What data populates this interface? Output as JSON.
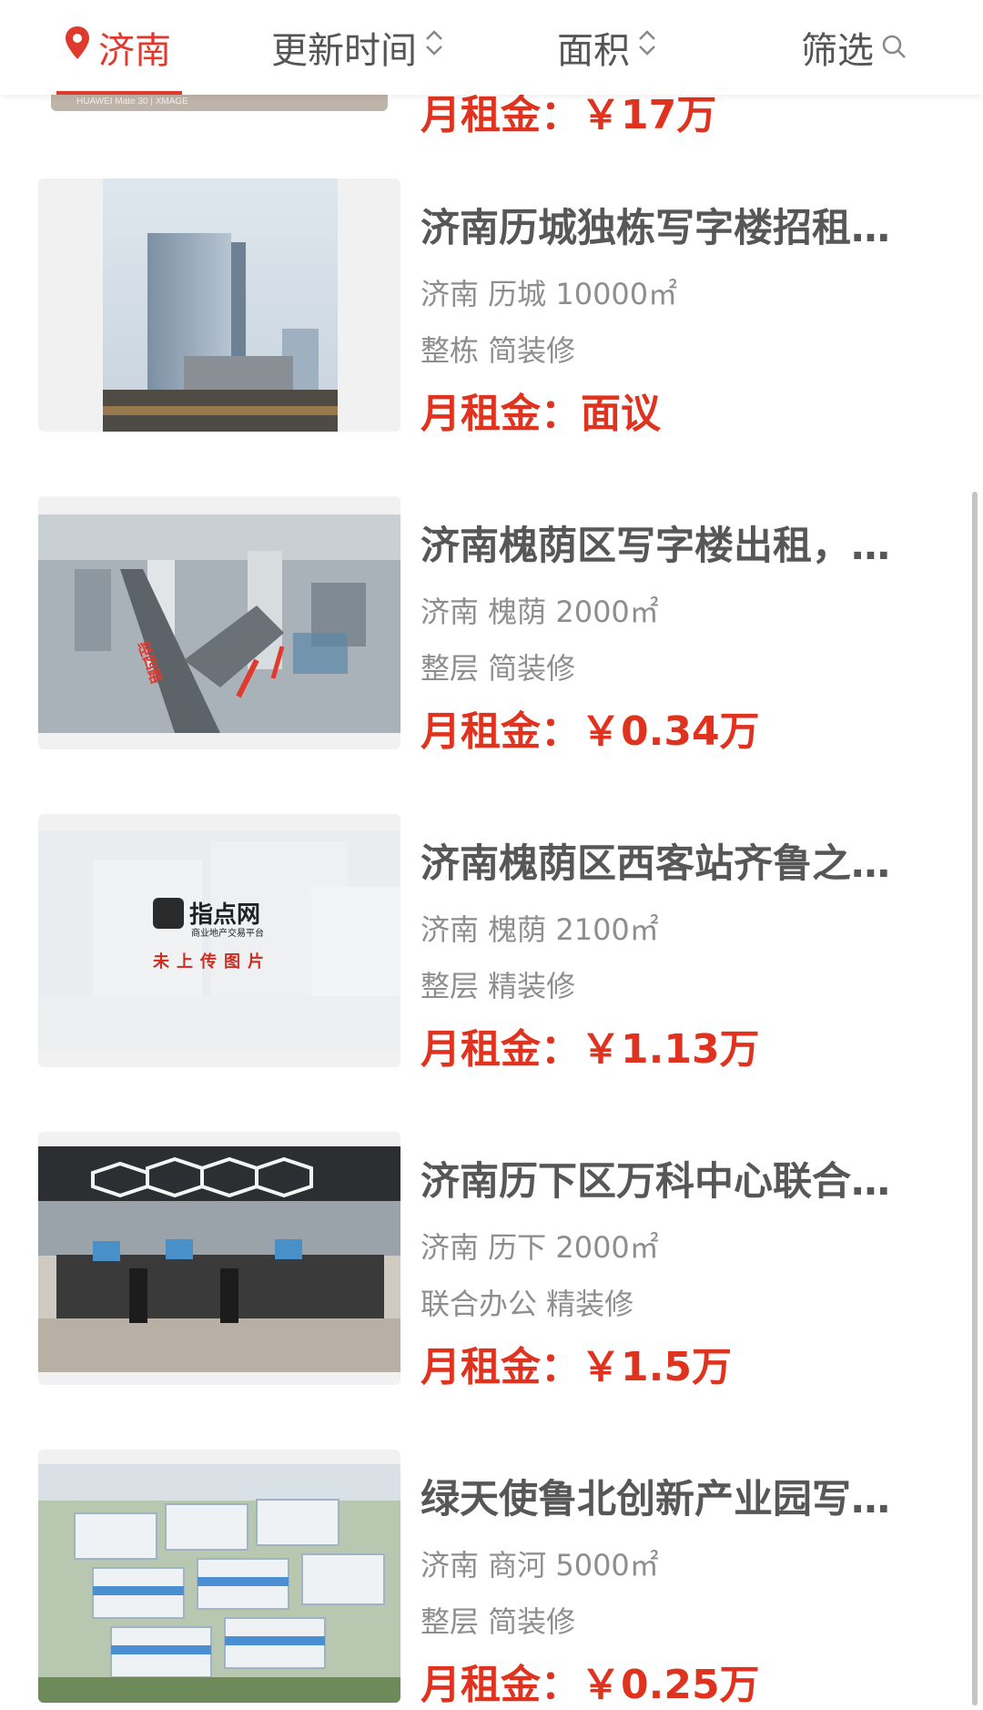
{
  "header": {
    "city": "济南",
    "sort_update": "更新时间",
    "sort_area": "面积",
    "filter": "筛选"
  },
  "listings": [
    {
      "title": "",
      "location": "",
      "spec": "",
      "price": "月租金：￥17万",
      "image_caption": "HUAWEI Mate 30 | XMAGE"
    },
    {
      "title": "济南历城独栋写字楼招租…",
      "location": "济南 历城 10000㎡",
      "spec": "整栋 简装修",
      "price": "月租金：面议"
    },
    {
      "title": "济南槐荫区写字楼出租，…",
      "location": "济南 槐荫 2000㎡",
      "spec": "整层 简装修",
      "price": "月租金：￥0.34万",
      "image_caption": "经四路"
    },
    {
      "title": "济南槐荫区西客站齐鲁之…",
      "location": "济南 槐荫 2100㎡",
      "spec": "整层 精装修",
      "price": "月租金：￥1.13万",
      "placeholder_logo": "指点网",
      "placeholder_sub": "商业地产交易平台",
      "placeholder_note": "未上传图片"
    },
    {
      "title": "济南历下区万科中心联合…",
      "location": "济南 历下 2000㎡",
      "spec": "联合办公 精装修",
      "price": "月租金：￥1.5万"
    },
    {
      "title": "绿天使鲁北创新产业园写…",
      "location": "济南 商河 5000㎡",
      "spec": "整层 简装修",
      "price": "月租金：￥0.25万"
    }
  ],
  "colors": {
    "accent": "#e0331f",
    "title": "#575757",
    "meta": "#8e8e8e"
  },
  "icons": {
    "city": "location-pin-icon",
    "sort": "sort-updown-icon",
    "filter": "search-icon"
  }
}
